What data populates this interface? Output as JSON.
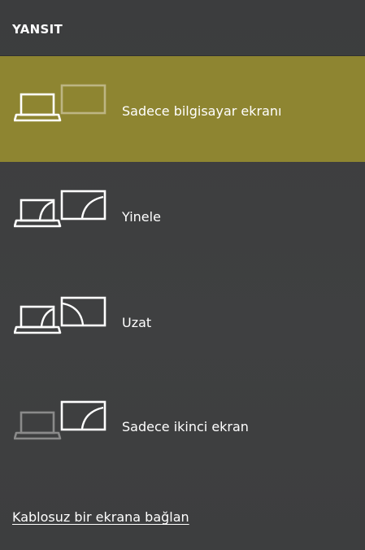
{
  "panel": {
    "title": "YANSIT",
    "options": [
      {
        "label": "Sadece bilgisayar ekranı",
        "icon": "pc-screen-only-icon",
        "selected": true
      },
      {
        "label": "Yinele",
        "icon": "duplicate-icon",
        "selected": false
      },
      {
        "label": "Uzat",
        "icon": "extend-icon",
        "selected": false
      },
      {
        "label": "Sadece ikinci ekran",
        "icon": "second-screen-only-icon",
        "selected": false
      }
    ],
    "wireless_link": "Kablosuz bir ekrana bağlan"
  },
  "colors": {
    "background": "#3e3f40",
    "selected_accent": "#8e8531",
    "text": "#ffffff",
    "dim_icon": "#8a8a8a"
  }
}
